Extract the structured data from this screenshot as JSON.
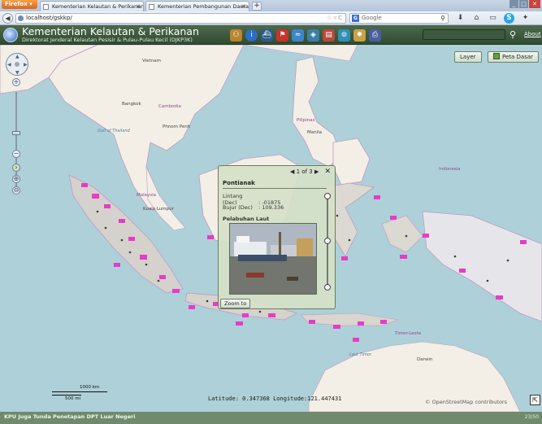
{
  "browser": {
    "menu_button": "Firefox ▾",
    "tabs": [
      {
        "label": "Kementerian Kelautan & Perikanan",
        "close": "✕"
      },
      {
        "label": "Kementerian Pembangunan Daerah Tertinggal",
        "close": "✕"
      }
    ],
    "new_tab": "+",
    "url": "localhost/gskkp/",
    "search_placeholder": "Google",
    "search_engine_glyph": "G",
    "window_buttons": [
      "_",
      "□",
      "✕"
    ]
  },
  "app": {
    "title": "Kementerian Kelautan & Perikanan",
    "subtitle": "Direktorat Jenderal Kelautan Pesisir & Pulau-Pulau Kecil (DJKP3K)",
    "about": "About",
    "toolbar_icons": [
      "user-icon",
      "info-icon",
      "ship-icon",
      "flag-icon",
      "wave-icon",
      "fish-icon",
      "chart-icon",
      "link-icon",
      "map-icon",
      "print-icon"
    ],
    "accent_color": "#3f5b40"
  },
  "map": {
    "layer_button": "Layer",
    "basemap_button": "Peta Dasar",
    "scale": {
      "large": "1000 km",
      "small": "500 mi"
    },
    "coords": {
      "latitude_label": "Latitude:",
      "latitude": "0.347368",
      "longitude_label": "Longitude:",
      "longitude": "121.447431"
    },
    "attribution": "© OpenStreetMap contributors",
    "maximize_glyph": "⇱",
    "labels": {
      "vietnam": "Vietnam",
      "bangkok": "Bangkok",
      "cambodia": "Cambodia",
      "phnom_penh": "Phnom Penh",
      "malaysia": "Malaysia",
      "kuala_lumpur": "Kuala Lumpur",
      "indonesia": "Indonesia",
      "darwin": "Darwin",
      "laut_timor": "Laut Timor",
      "timor_leste": "Timor-Leste",
      "gulf_of_thailand": "Gulf of Thailand",
      "hanoi": "Hà Nội",
      "manila": "Manila",
      "philippines": "Pilipinas"
    }
  },
  "popup": {
    "pager": "1 of 3",
    "close": "✕",
    "prev": "◀",
    "next": "▶",
    "title": "Pontianak",
    "rows": [
      {
        "label": "Lintang (Dec)",
        "value": ": -01875"
      },
      {
        "label": "Bujur (Dec)",
        "value": ": 109.336"
      }
    ],
    "section": "Pelabuhan Laut",
    "zoom_button": "Zoom to"
  },
  "status": {
    "headline": "KPU Juga Tunda Penetapan DPT Luar Negeri",
    "count": "23/50"
  }
}
